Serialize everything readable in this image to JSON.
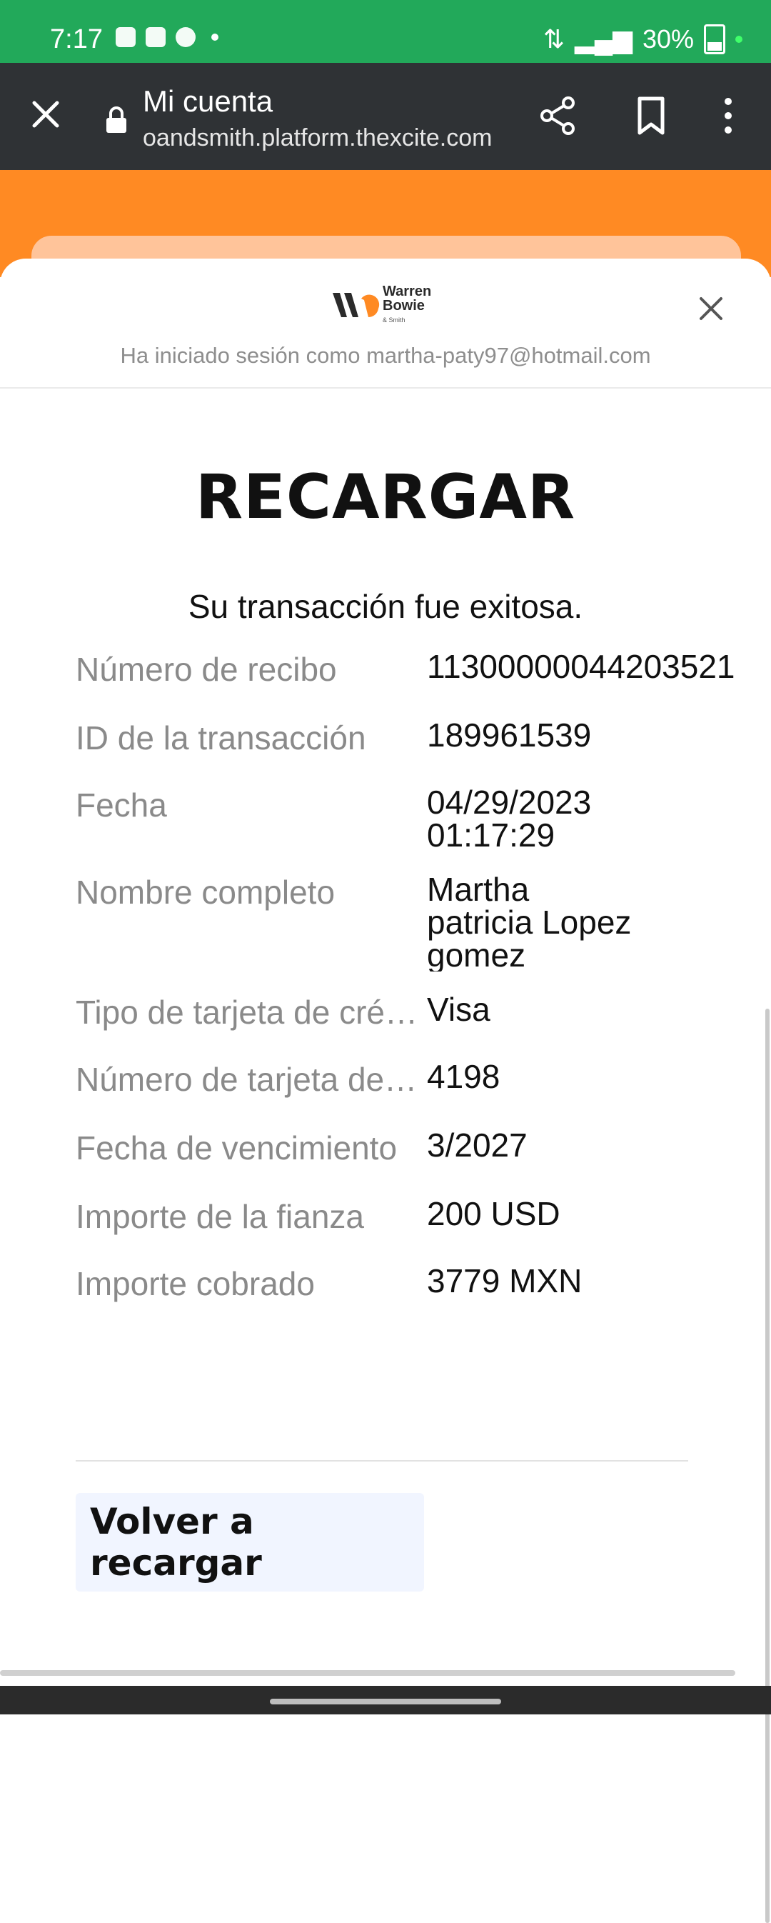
{
  "status_bar": {
    "time": "7:17",
    "battery": "30%"
  },
  "browser": {
    "title": "Mi cuenta",
    "url": "oandsmith.platform.thexcite.com"
  },
  "brand": {
    "line1": "Warren",
    "line2": "Bowie",
    "line3": "& Smith"
  },
  "account": {
    "signed_in_text": "Ha iniciado sesión como martha-paty97@hotmail.com"
  },
  "page": {
    "title": "RECARGAR",
    "success_message": "Su transacción fue exitosa."
  },
  "details": [
    {
      "label": "Número de recibo",
      "value": "11300000044203521"
    },
    {
      "label": "ID de la transacción",
      "value": "189961539"
    },
    {
      "label": "Fecha",
      "value": "04/29/2023\n01:17:29"
    },
    {
      "label": "Nombre completo",
      "value": "Martha\npatricia Lopez\ngomez"
    },
    {
      "label": "Tipo de tarjeta de crédito",
      "value": "Visa"
    },
    {
      "label": "Número de tarjeta de crédito",
      "value": "4198"
    },
    {
      "label": "Fecha de vencimiento",
      "value": "3/2027"
    },
    {
      "label": "Importe de la fianza",
      "value": "200 USD"
    },
    {
      "label": "Importe cobrado",
      "value": "3779 MXN"
    }
  ],
  "actions": {
    "recharge_again": "Volver a recargar"
  },
  "colors": {
    "status_green": "#22a95a",
    "toolbar": "#2f3235",
    "brand_orange": "#ff8a23"
  }
}
